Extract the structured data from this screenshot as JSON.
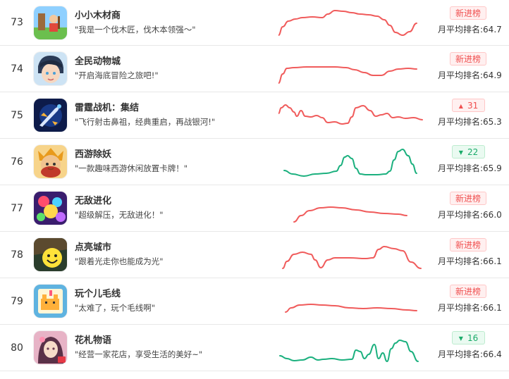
{
  "colors": {
    "up": "#f05b5b",
    "down": "#1bb07e"
  },
  "rows": [
    {
      "rank": "73",
      "name": "小小木材商",
      "desc": "\"我是一个伐木匠，伐木本领强～\"",
      "badge": {
        "kind": "new",
        "text": "新进榜"
      },
      "avg": "月平均排名:64.7",
      "trend": "up",
      "icon": "woodcutter-icon",
      "spark": [
        [
          0,
          42
        ],
        [
          6,
          30
        ],
        [
          14,
          22
        ],
        [
          24,
          19
        ],
        [
          34,
          17
        ],
        [
          48,
          16
        ],
        [
          62,
          17
        ],
        [
          70,
          12
        ],
        [
          80,
          7
        ],
        [
          92,
          8
        ],
        [
          104,
          10
        ],
        [
          116,
          12
        ],
        [
          128,
          13
        ],
        [
          140,
          15
        ],
        [
          150,
          20
        ],
        [
          158,
          28
        ],
        [
          166,
          38
        ],
        [
          176,
          42
        ],
        [
          186,
          37
        ],
        [
          196,
          25
        ]
      ]
    },
    {
      "rank": "74",
      "name": "全民动物城",
      "desc": "\"开启海底冒险之旅吧!\"",
      "badge": {
        "kind": "new",
        "text": "新进榜"
      },
      "avg": "月平均排名:64.9",
      "trend": "up",
      "icon": "hero-boy-icon",
      "spark": [
        [
          0,
          45
        ],
        [
          6,
          32
        ],
        [
          12,
          24
        ],
        [
          22,
          23
        ],
        [
          40,
          22
        ],
        [
          60,
          22
        ],
        [
          80,
          22
        ],
        [
          96,
          23
        ],
        [
          108,
          26
        ],
        [
          122,
          30
        ],
        [
          134,
          34
        ],
        [
          146,
          34
        ],
        [
          158,
          28
        ],
        [
          170,
          25
        ],
        [
          184,
          24
        ],
        [
          196,
          25
        ]
      ]
    },
    {
      "rank": "75",
      "name": "雷霆战机：集结",
      "desc": "\"飞行射击鼻祖，经典重启，再战银河!\"",
      "badge": {
        "kind": "up",
        "text": "31"
      },
      "avg": "月平均排名:65.3",
      "trend": "up",
      "icon": "fighter-jet-icon",
      "spark": [
        [
          0,
          22
        ],
        [
          4,
          14
        ],
        [
          10,
          10
        ],
        [
          16,
          14
        ],
        [
          22,
          20
        ],
        [
          26,
          26
        ],
        [
          32,
          18
        ],
        [
          38,
          26
        ],
        [
          46,
          27
        ],
        [
          54,
          25
        ],
        [
          62,
          28
        ],
        [
          70,
          35
        ],
        [
          80,
          34
        ],
        [
          90,
          37
        ],
        [
          98,
          36
        ],
        [
          104,
          27
        ],
        [
          110,
          14
        ],
        [
          120,
          11
        ],
        [
          130,
          18
        ],
        [
          138,
          26
        ],
        [
          146,
          24
        ],
        [
          154,
          22
        ],
        [
          162,
          28
        ],
        [
          170,
          27
        ],
        [
          180,
          29
        ],
        [
          192,
          28
        ],
        [
          204,
          31
        ]
      ]
    },
    {
      "rank": "76",
      "name": "西游除妖",
      "desc": "\"一款趣味西游休闲放置卡牌！\"",
      "badge": {
        "kind": "down",
        "text": "22"
      },
      "avg": "月平均排名:65.9",
      "trend": "down",
      "icon": "monkey-king-icon",
      "spark": [
        [
          8,
          37
        ],
        [
          20,
          42
        ],
        [
          36,
          45
        ],
        [
          52,
          42
        ],
        [
          68,
          41
        ],
        [
          82,
          38
        ],
        [
          88,
          30
        ],
        [
          94,
          18
        ],
        [
          98,
          16
        ],
        [
          104,
          20
        ],
        [
          110,
          34
        ],
        [
          116,
          42
        ],
        [
          124,
          43
        ],
        [
          140,
          43
        ],
        [
          152,
          42
        ],
        [
          158,
          38
        ],
        [
          164,
          22
        ],
        [
          170,
          10
        ],
        [
          176,
          7
        ],
        [
          184,
          16
        ],
        [
          190,
          28
        ],
        [
          196,
          41
        ]
      ]
    },
    {
      "rank": "77",
      "name": "无敌进化",
      "desc": "\"超级解压，无敌进化！\"",
      "badge": {
        "kind": "new",
        "text": "新进榜"
      },
      "avg": "月平均排名:66.0",
      "trend": "up",
      "icon": "bubbles-icon",
      "spark": [
        [
          22,
          44
        ],
        [
          32,
          35
        ],
        [
          44,
          28
        ],
        [
          60,
          24
        ],
        [
          74,
          23
        ],
        [
          90,
          24
        ],
        [
          110,
          27
        ],
        [
          130,
          30
        ],
        [
          150,
          32
        ],
        [
          170,
          33
        ],
        [
          182,
          35
        ]
      ]
    },
    {
      "rank": "78",
      "name": "点亮城市",
      "desc": "\"跟着光走你也能成为光\"",
      "badge": {
        "kind": "new",
        "text": "新进榜"
      },
      "avg": "月平均排名:66.1",
      "trend": "up",
      "icon": "smiley-icon",
      "spark": [
        [
          6,
          44
        ],
        [
          12,
          34
        ],
        [
          22,
          24
        ],
        [
          34,
          21
        ],
        [
          46,
          24
        ],
        [
          52,
          32
        ],
        [
          60,
          43
        ],
        [
          70,
          32
        ],
        [
          80,
          29
        ],
        [
          100,
          29
        ],
        [
          124,
          30
        ],
        [
          134,
          29
        ],
        [
          142,
          17
        ],
        [
          150,
          13
        ],
        [
          164,
          16
        ],
        [
          176,
          19
        ],
        [
          188,
          35
        ],
        [
          202,
          44
        ]
      ]
    },
    {
      "rank": "79",
      "name": "玩个儿毛线",
      "desc": "\"太难了，玩个毛线啊\"",
      "badge": {
        "kind": "new",
        "text": "新进榜"
      },
      "avg": "月平均排名:66.1",
      "trend": "up",
      "icon": "yarn-cat-icon",
      "spark": [
        [
          10,
          40
        ],
        [
          18,
          34
        ],
        [
          30,
          30
        ],
        [
          46,
          29
        ],
        [
          62,
          30
        ],
        [
          80,
          31
        ],
        [
          100,
          34
        ],
        [
          120,
          35
        ],
        [
          140,
          34
        ],
        [
          160,
          35
        ],
        [
          182,
          37
        ],
        [
          196,
          38
        ]
      ]
    },
    {
      "rank": "80",
      "name": "花札物语",
      "desc": "\"经营一家花店，享受生活的美好~\"",
      "badge": {
        "kind": "down",
        "text": "16"
      },
      "avg": "月平均排名:66.4",
      "trend": "down",
      "icon": "girl-portrait-icon",
      "spark": [
        [
          2,
          36
        ],
        [
          12,
          40
        ],
        [
          22,
          43
        ],
        [
          34,
          42
        ],
        [
          46,
          38
        ],
        [
          56,
          42
        ],
        [
          64,
          41
        ],
        [
          76,
          40
        ],
        [
          90,
          42
        ],
        [
          104,
          41
        ],
        [
          110,
          28
        ],
        [
          116,
          30
        ],
        [
          122,
          40
        ],
        [
          128,
          34
        ],
        [
          136,
          20
        ],
        [
          142,
          40
        ],
        [
          148,
          32
        ],
        [
          154,
          44
        ],
        [
          160,
          26
        ],
        [
          166,
          18
        ],
        [
          172,
          14
        ],
        [
          180,
          16
        ],
        [
          188,
          30
        ],
        [
          198,
          44
        ]
      ]
    }
  ]
}
